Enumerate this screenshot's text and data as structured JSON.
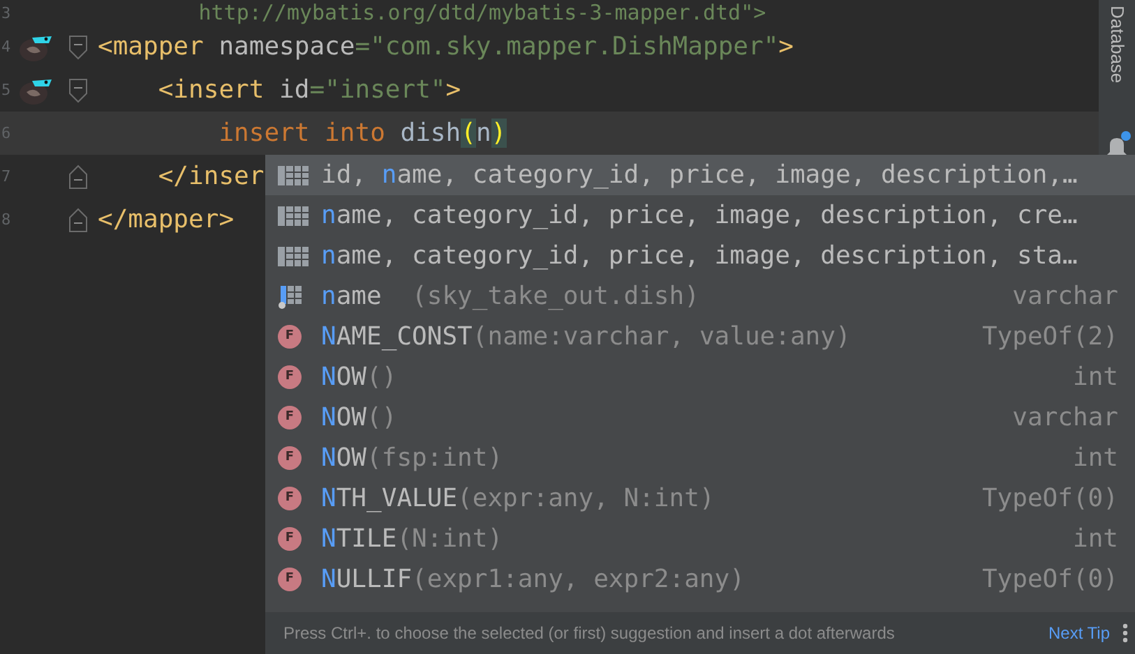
{
  "editor": {
    "lines": [
      {
        "number": "3",
        "fold_start": false,
        "fold_end": false,
        "mapper_marker": false,
        "current": false,
        "tokens": [
          {
            "kind": "value",
            "text": "        http://mybatis.org/dtd/mybatis-3-mapper.dtd\">"
          }
        ]
      },
      {
        "number": "4",
        "fold_start": true,
        "fold_end": false,
        "mapper_marker": true,
        "current": false,
        "tokens": [
          {
            "kind": "tag",
            "text": "<mapper"
          },
          {
            "kind": "attr",
            "text": " namespace"
          },
          {
            "kind": "value",
            "text": "=\"com.sky.mapper.DishMapper\""
          },
          {
            "kind": "tag",
            "text": ">"
          }
        ]
      },
      {
        "number": "5",
        "fold_start": true,
        "fold_end": false,
        "mapper_marker": true,
        "current": false,
        "tokens": [
          {
            "kind": "tag",
            "text": "    <insert"
          },
          {
            "kind": "attr",
            "text": " id"
          },
          {
            "kind": "value",
            "text": "=\"insert\""
          },
          {
            "kind": "tag",
            "text": ">"
          }
        ]
      },
      {
        "number": "6",
        "fold_start": false,
        "fold_end": false,
        "mapper_marker": false,
        "current": true,
        "tokens": [
          {
            "kind": "keyword",
            "text": "        insert into"
          },
          {
            "kind": "plain",
            "text": " dish"
          },
          {
            "kind": "paren",
            "text": "("
          },
          {
            "kind": "plain",
            "text": "n"
          },
          {
            "kind": "paren",
            "text": ")"
          }
        ]
      },
      {
        "number": "7",
        "fold_start": false,
        "fold_end": true,
        "mapper_marker": false,
        "current": false,
        "tokens": [
          {
            "kind": "tag",
            "text": "    </inser"
          }
        ]
      },
      {
        "number": "8",
        "fold_start": false,
        "fold_end": true,
        "mapper_marker": false,
        "current": false,
        "tokens": [
          {
            "kind": "tag",
            "text": "</mapper>"
          }
        ]
      }
    ]
  },
  "tool_window_strip": {
    "label": "Database",
    "notification": true
  },
  "completion": {
    "items": [
      {
        "kind": "table",
        "selected": true,
        "before": "id, ",
        "match": "n",
        "after": "ame, category_id, price, image, description,…"
      },
      {
        "kind": "table",
        "selected": false,
        "match": "n",
        "after": "ame, category_id, price, image, description, cre…"
      },
      {
        "kind": "table",
        "selected": false,
        "match": "n",
        "after": "ame, category_id, price, image, description, sta…"
      },
      {
        "kind": "column",
        "selected": false,
        "match": "n",
        "after": "ame",
        "params": "  (sky_take_out.dish)",
        "type": "varchar"
      },
      {
        "kind": "function",
        "badge": "F",
        "selected": false,
        "match": "N",
        "after": "AME_CONST",
        "params": "(name:varchar, value:any)",
        "type": "TypeOf(2)"
      },
      {
        "kind": "function",
        "badge": "F",
        "selected": false,
        "match": "N",
        "after": "OW",
        "params": "()",
        "type": "int"
      },
      {
        "kind": "function",
        "badge": "F",
        "selected": false,
        "match": "N",
        "after": "OW",
        "params": "()",
        "type": "varchar"
      },
      {
        "kind": "function",
        "badge": "F",
        "selected": false,
        "match": "N",
        "after": "OW",
        "params": "(fsp:int)",
        "type": "int"
      },
      {
        "kind": "function",
        "badge": "F",
        "selected": false,
        "match": "N",
        "after": "TH_VALUE",
        "params": "(expr:any, N:int)",
        "type": "TypeOf(0)"
      },
      {
        "kind": "function",
        "badge": "F",
        "selected": false,
        "match": "N",
        "after": "TILE",
        "params": "(N:int)",
        "type": "int"
      },
      {
        "kind": "function",
        "badge": "F",
        "selected": false,
        "match": "N",
        "after": "ULLIF",
        "params": "(expr1:any, expr2:any)",
        "type": "TypeOf(0)"
      }
    ],
    "footer": {
      "hint": "Press Ctrl+. to choose the selected (or first) suggestion and insert a dot afterwards",
      "link": "Next Tip"
    }
  }
}
